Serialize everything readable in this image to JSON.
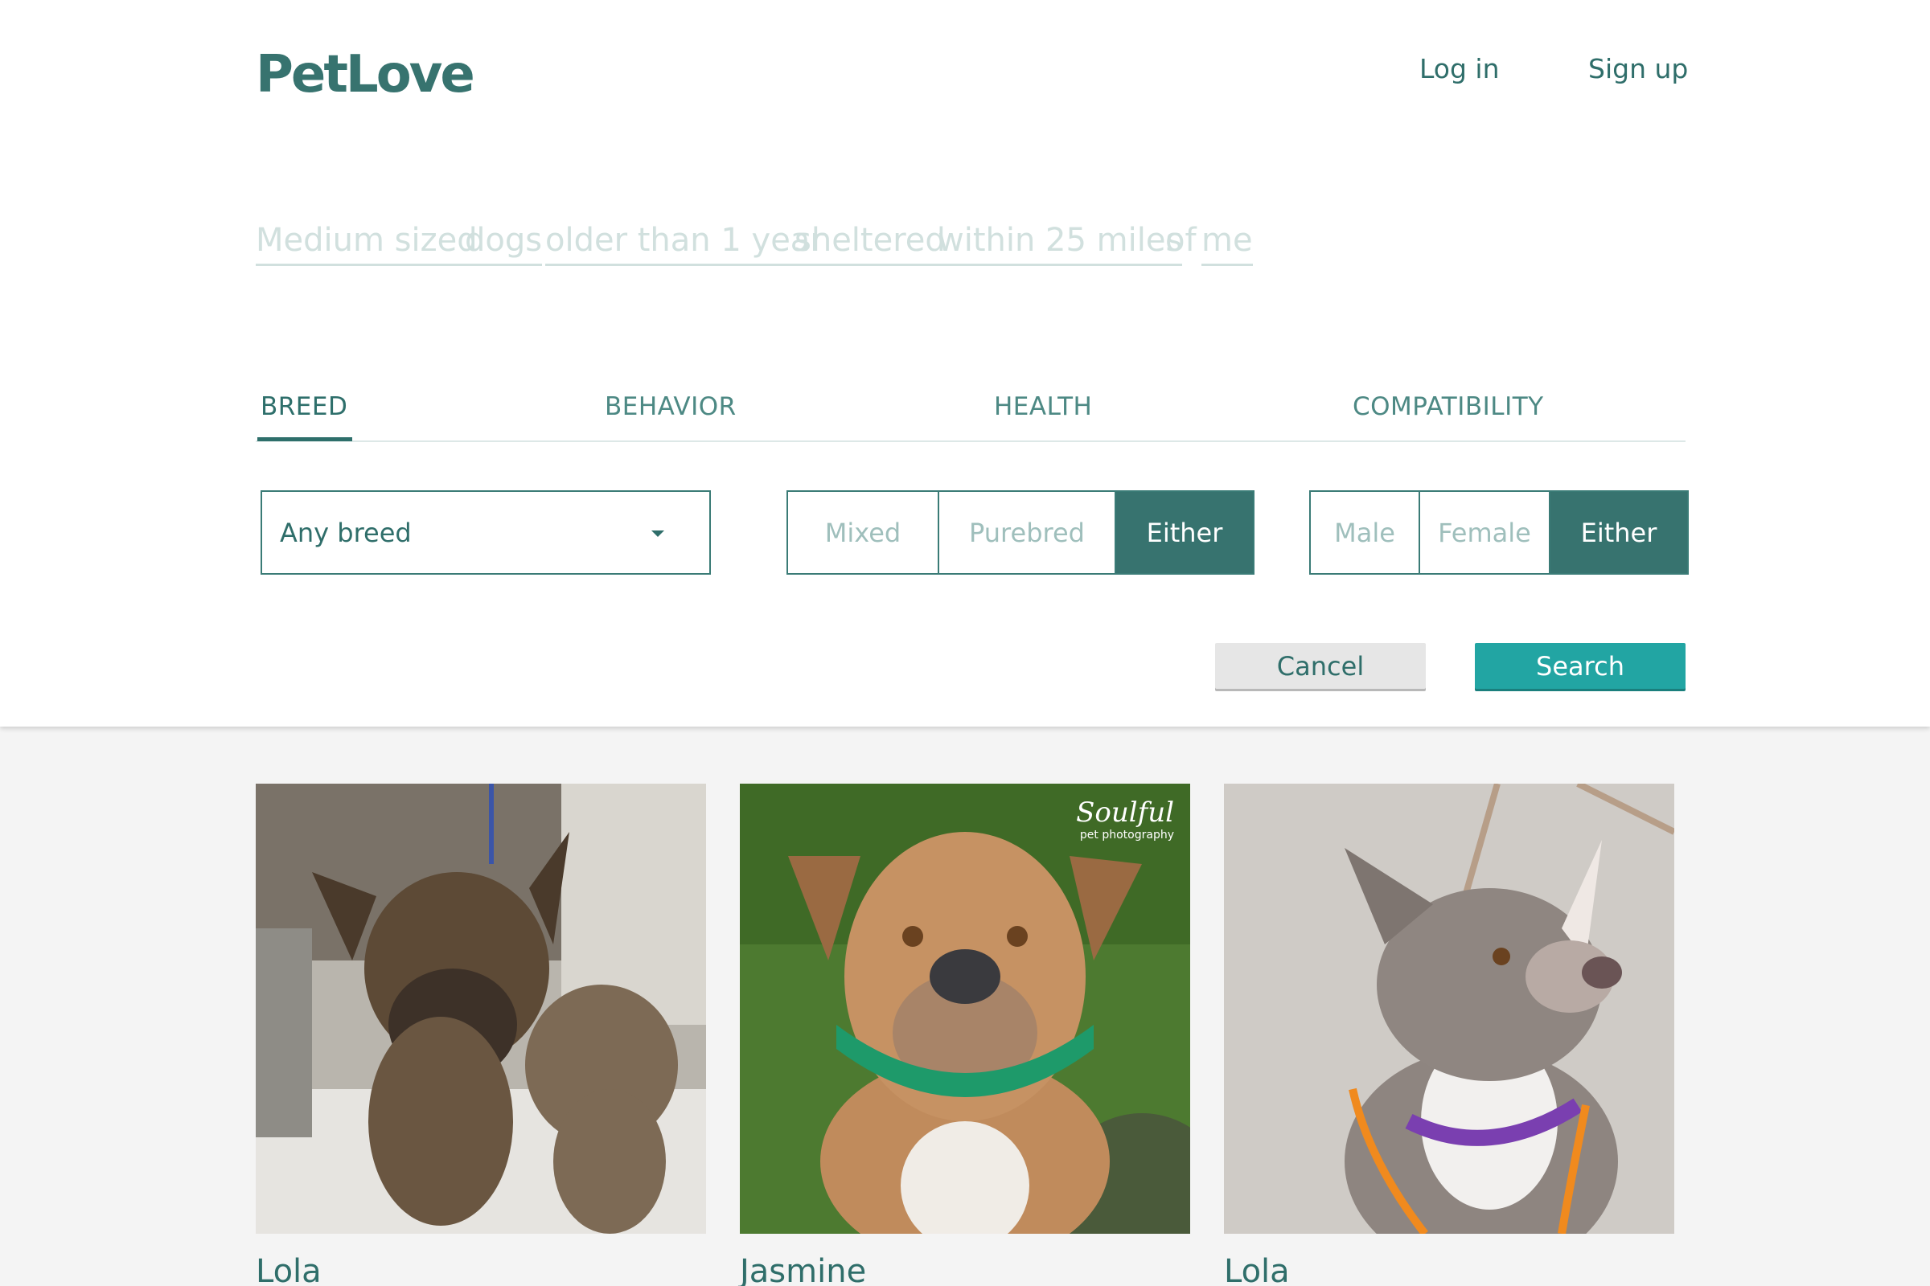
{
  "header": {
    "logo": "PetLove",
    "login_label": "Log in",
    "signup_label": "Sign up"
  },
  "query": {
    "size": "Medium sized",
    "species": "dogs",
    "age": "older than 1 year",
    "status": "sheltered",
    "distance": "within 25 miles",
    "of": "of",
    "location": "me"
  },
  "tabs": [
    {
      "label": "BREED",
      "active": true
    },
    {
      "label": "BEHAVIOR",
      "active": false
    },
    {
      "label": "HEALTH",
      "active": false
    },
    {
      "label": "COMPATIBILITY",
      "active": false
    }
  ],
  "filters": {
    "breed_select": "Any breed",
    "breed_type": {
      "options": [
        "Mixed",
        "Purebred",
        "Either"
      ],
      "selected": "Either"
    },
    "sex": {
      "options": [
        "Male",
        "Female",
        "Either"
      ],
      "selected": "Either"
    }
  },
  "actions": {
    "cancel_label": "Cancel",
    "search_label": "Search"
  },
  "results": [
    {
      "name": "Lola"
    },
    {
      "name": "Jasmine",
      "watermark": "Soulful",
      "watermark_sub": "pet photography"
    },
    {
      "name": "Lola"
    }
  ],
  "colors": {
    "primary": "#37736f",
    "search_button": "#22a5a3",
    "query_faded": "#d1e0de"
  }
}
